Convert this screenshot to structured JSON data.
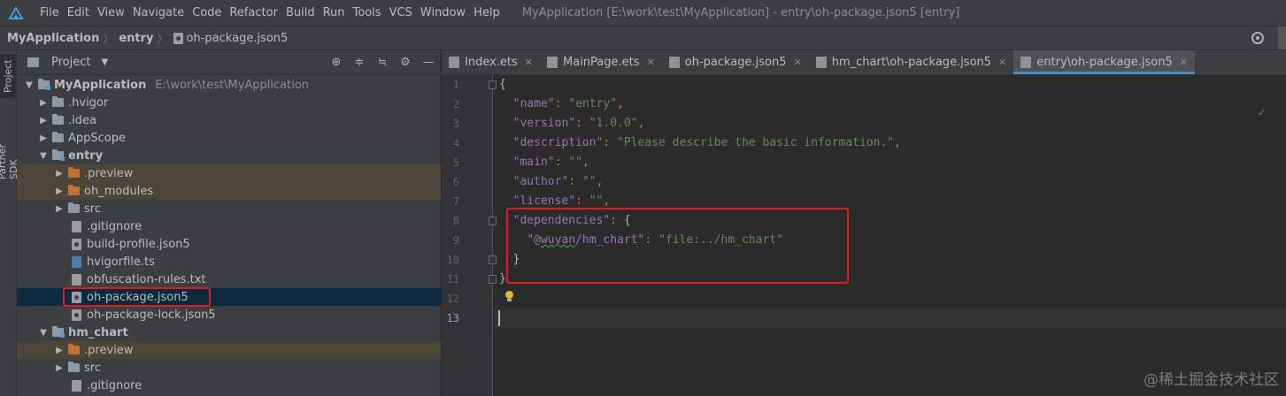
{
  "menubar": {
    "items": [
      "File",
      "Edit",
      "View",
      "Navigate",
      "Code",
      "Refactor",
      "Build",
      "Run",
      "Tools",
      "VCS",
      "Window",
      "Help"
    ],
    "window_title": "MyApplication [E:\\work\\test\\MyApplication] - entry\\oh-package.json5 [entry]"
  },
  "breadcrumb": {
    "items": [
      "MyApplication",
      "entry",
      "oh-package.json5"
    ]
  },
  "stripe": {
    "project": "Project",
    "sdk": "Partner SDK"
  },
  "project_panel": {
    "title": "Project",
    "tree": [
      {
        "label": "MyApplication",
        "path": "E:\\work\\test\\MyApplication",
        "icon": "folder-module"
      },
      {
        "label": ".hvigor",
        "icon": "folder"
      },
      {
        "label": ".idea",
        "icon": "folder"
      },
      {
        "label": "AppScope",
        "icon": "folder"
      },
      {
        "label": "entry",
        "icon": "folder-module"
      },
      {
        "label": ".preview",
        "icon": "folder-excluded"
      },
      {
        "label": "oh_modules",
        "icon": "folder-excluded"
      },
      {
        "label": "src",
        "icon": "folder"
      },
      {
        "label": ".gitignore",
        "icon": "file"
      },
      {
        "label": "build-profile.json5",
        "icon": "json-file"
      },
      {
        "label": "hvigorfile.ts",
        "icon": "ts-file"
      },
      {
        "label": "obfuscation-rules.txt",
        "icon": "text-file"
      },
      {
        "label": "oh-package.json5",
        "icon": "json-file"
      },
      {
        "label": "oh-package-lock.json5",
        "icon": "json-file"
      },
      {
        "label": "hm_chart",
        "icon": "folder-module"
      },
      {
        "label": ".preview",
        "icon": "folder-excluded"
      },
      {
        "label": "src",
        "icon": "folder"
      },
      {
        "label": ".gitignore",
        "icon": "file"
      }
    ]
  },
  "editor": {
    "tabs": [
      {
        "label": "Index.ets"
      },
      {
        "label": "MainPage.ets"
      },
      {
        "label": "oh-package.json5"
      },
      {
        "label": "hm_chart\\oh-package.json5"
      },
      {
        "label": "entry\\oh-package.json5"
      }
    ],
    "line_numbers": [
      "1",
      "2",
      "3",
      "4",
      "5",
      "6",
      "7",
      "8",
      "9",
      "10",
      "11",
      "12",
      "13"
    ],
    "code": {
      "l1": "{",
      "name_key": "\"name\"",
      "name_val": "\"entry\"",
      "version_key": "\"version\"",
      "version_val": "\"1.0.0\"",
      "desc_key": "\"description\"",
      "desc_val": "\"Please describe the basic information.\"",
      "main_key": "\"main\"",
      "main_val": "\"\"",
      "author_key": "\"author\"",
      "author_val": "\"\"",
      "license_key": "\"license\"",
      "license_val": "\"\"",
      "deps_key": "\"dependencies\"",
      "dep_key_pre": "\"@",
      "dep_key_typo": "wuyan",
      "dep_key_post": "/hm_chart\"",
      "dep_val": "\"file:../hm_chart\"",
      "close_inner": "}",
      "close_outer": "}"
    }
  },
  "watermark": "@稀土掘金技术社区",
  "colors": {
    "highlight_box": "#e8191d",
    "active_tab_underline": "#4a88c7",
    "selection_bg": "#0d293e"
  }
}
